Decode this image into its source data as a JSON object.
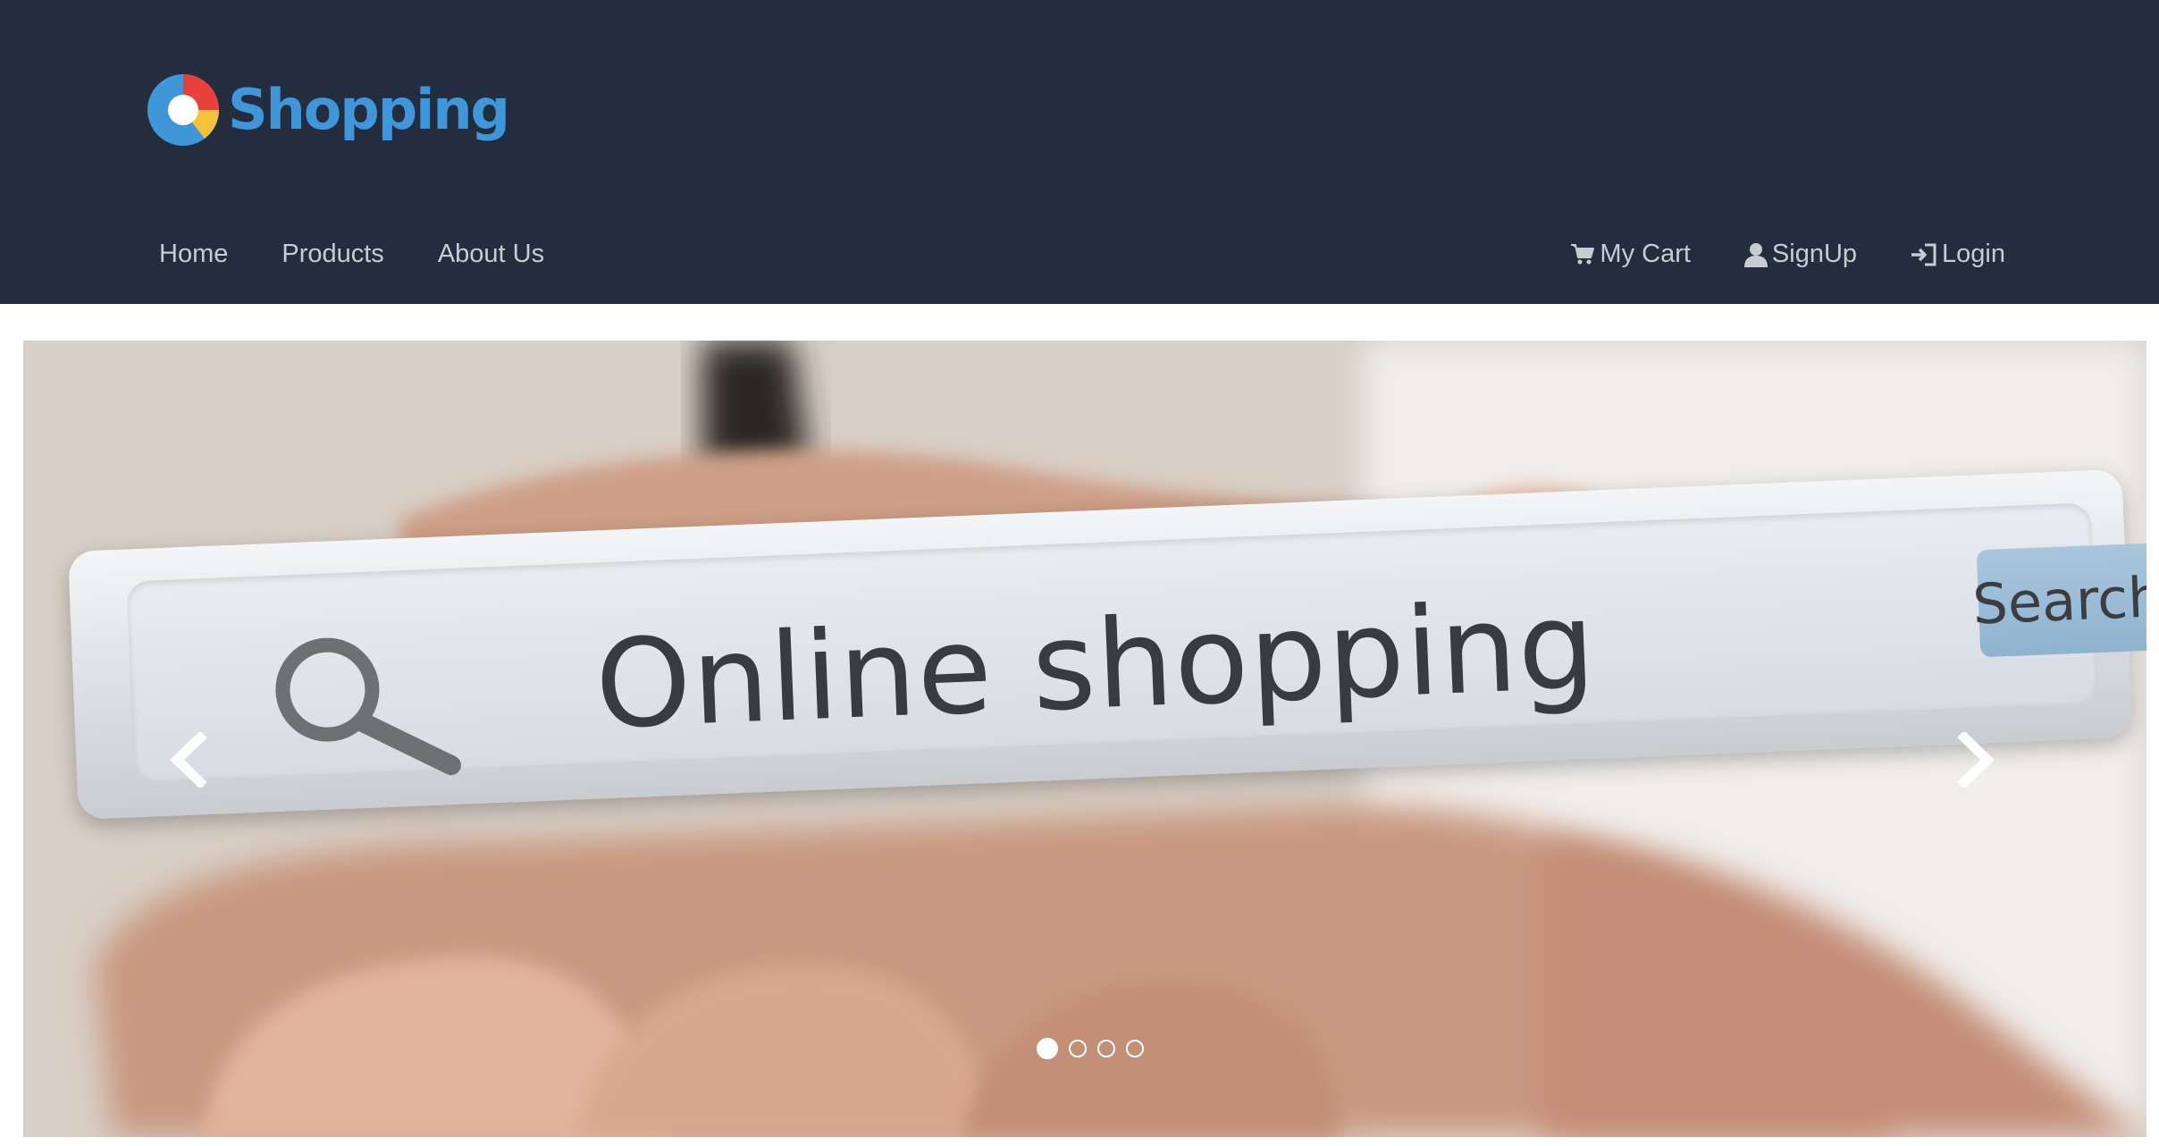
{
  "header": {
    "brand": "Shopping",
    "nav_left": [
      {
        "label": "Home"
      },
      {
        "label": "Products"
      },
      {
        "label": "About Us"
      }
    ],
    "nav_right": [
      {
        "label": "My Cart",
        "icon": "cart-icon"
      },
      {
        "label": "SignUp",
        "icon": "user-icon"
      },
      {
        "label": "Login",
        "icon": "login-icon"
      }
    ]
  },
  "carousel": {
    "slide_text": "Online shopping",
    "slide_button_text": "Search",
    "prev_icon": "chevron-left-icon",
    "next_icon": "chevron-right-icon",
    "active_slide": 1,
    "total_slides": 4
  },
  "colors": {
    "header_bg": "#242d3e",
    "brand": "#3f97d9",
    "nav_text": "#c7ccd3"
  }
}
